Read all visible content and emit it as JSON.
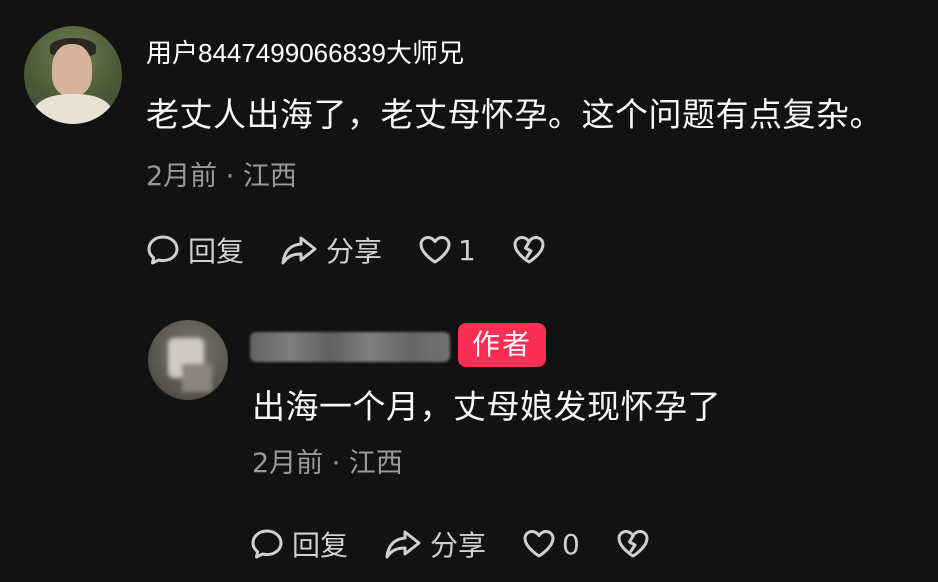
{
  "comment": {
    "username": "用户8447499066839大师兄",
    "text": "老丈人出海了，老丈母怀孕。这个问题有点复杂。",
    "meta": "2月前 · 江西",
    "actions": {
      "reply_label": "回复",
      "share_label": "分享",
      "like_count": "1"
    }
  },
  "reply": {
    "badge": "作者",
    "text": "出海一个月，丈母娘发现怀孕了",
    "meta": "2月前 · 江西",
    "actions": {
      "reply_label": "回复",
      "share_label": "分享",
      "like_count": "0"
    }
  },
  "icons": {
    "reply": "comment-bubble-icon",
    "share": "share-arrow-icon",
    "like": "heart-icon",
    "dislike": "broken-heart-icon"
  },
  "colors": {
    "background": "#121212",
    "badge": "#fb2e55",
    "secondary_text": "#9a9a9a"
  }
}
